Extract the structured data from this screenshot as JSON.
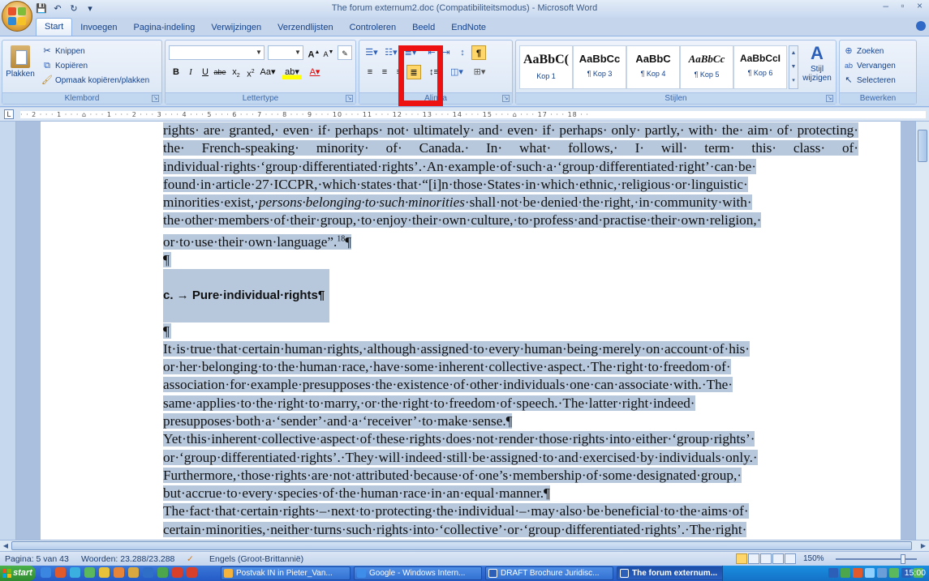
{
  "window": {
    "title": "The forum externum2.doc (Compatibiliteitsmodus) - Microsoft Word",
    "controls": "– ▫ ×"
  },
  "quick_access": {
    "save": "💾",
    "undo": "↶",
    "redo": "↻",
    "customize": "▾"
  },
  "tabs": [
    "Start",
    "Invoegen",
    "Pagina-indeling",
    "Verwijzingen",
    "Verzendlijsten",
    "Controleren",
    "Beeld",
    "EndNote"
  ],
  "ribbon": {
    "clipboard": {
      "label": "Klembord",
      "paste": "Plakken",
      "cut": "Knippen",
      "copy": "Kopiëren",
      "format_painter": "Opmaak kopiëren/plakken"
    },
    "font": {
      "label": "Lettertype",
      "font_name": "",
      "font_size": ""
    },
    "paragraph": {
      "label": "Alinea"
    },
    "styles": {
      "label": "Stijlen",
      "items": [
        {
          "sample": "AaBbC(",
          "name": "Kop 1"
        },
        {
          "sample": "AaBbCc",
          "name": "¶ Kop 3"
        },
        {
          "sample": "AaBbC",
          "name": "¶ Kop 4"
        },
        {
          "sample": "AaBbCc",
          "name": "¶ Kop 5"
        },
        {
          "sample": "AaBbCcI",
          "name": "¶ Kop 6"
        }
      ],
      "change_styles": "Stijl wijzigen"
    },
    "editing": {
      "label": "Bewerken",
      "find": "Zoeken",
      "replace": "Vervangen",
      "select": "Selecteren"
    }
  },
  "ruler": {
    "marks": "· · 2 · · · 1 · · · ⌂ · · · 1 · · · 2 · · · 3 · · · 4 · · · 5 · · · 6 · · · 7 · · · 8 · · · 9 · · · 10 · · · 11 · · · 12 · · · 13 · · · 14 · · · 15 · · · ⌂ · · · 17 · · · 18 · ·"
  },
  "document": {
    "para1": "rights· are· granted,· even· if· perhaps· not· ultimately· and· even· if· perhaps· only· partly,· with· the· aim· of· protecting· the· French-speaking· minority· of· Canada.· In· what· follows,· I· will· term· this· class· of· individual·rights·‘group·differentiated·rights’.·An·example·of·such·a·‘group·differentiated·right’·can·be· found·in·article·27·ICCPR,·which·states·that·“[i]n·those·States·in·which·ethnic,·religious·or·linguistic· minorities·exist,·",
    "para1_italic": "persons·belonging·to·such·minorities",
    "para1_end": "·shall·not·be·denied·the·right,·in·community·with· the·other·members·of·their·group,·to·enjoy·their·own·culture,·to·profess·and·practise·their·own·religion,· or·to·use·their·own·language”.",
    "footnote": "18",
    "pilcrow": "¶",
    "heading": "c. → Pure·individual·rights¶",
    "para2": "It·is·true·that·certain·human·rights,·although·assigned·to·every·human·being·merely·on·account·of·his· or·her·belonging·to·the·human·race,·have·some·inherent·collective·aspect.·The·right·to·freedom·of· association·for·example·presupposes·the·existence·of·other·individuals·one·can·associate·with.·The· same·applies·to·the·right·to·marry,·or·the·right·to·freedom·of·speech.·The·latter·right·indeed· presupposes·both·a·‘sender’·and·a·‘receiver’·to·make·sense.¶",
    "para3": "Yet·this·inherent·collective·aspect·of·these·rights·does·not·render·those·rights·into·either·‘group·rights’· or·‘group·differentiated·rights’.·They·will·indeed·still·be·assigned·to·and·exercised·by·individuals·only.· Furthermore,·those·rights·are·not·attributed·because·of·one’s·membership·of·some·designated·group,· but·accrue·to·every·species·of·the·human·race·in·an·equal·manner.¶",
    "para4": "The·fact·that·certain·rights·–·next·to·protecting·the·individual·–·may·also·be·beneficial·to·the·aims·of· certain·minorities,·neither·turns·such·rights·into·‘collective’·or·‘group·differentiated·rights’.·The·right· to·protection·of·the·family·or·freedom·of·association"
  },
  "status": {
    "page": "Pagina: 5 van 43",
    "words": "Woorden: 23.288/23.288",
    "language": "Engels (Groot-Brittannië)",
    "zoom": "150%"
  },
  "taskbar": {
    "start": "start",
    "items": [
      {
        "label": "Postvak IN in Pieter_Van...",
        "color": "#f3b33c"
      },
      {
        "label": "Google - Windows Intern...",
        "color": "#3e8de8"
      },
      {
        "label": "DRAFT Brochure Juridisc...",
        "color": "#2b5fb8"
      },
      {
        "label": "The forum externum...",
        "color": "#2b5fb8"
      }
    ],
    "clock": "15:00"
  }
}
